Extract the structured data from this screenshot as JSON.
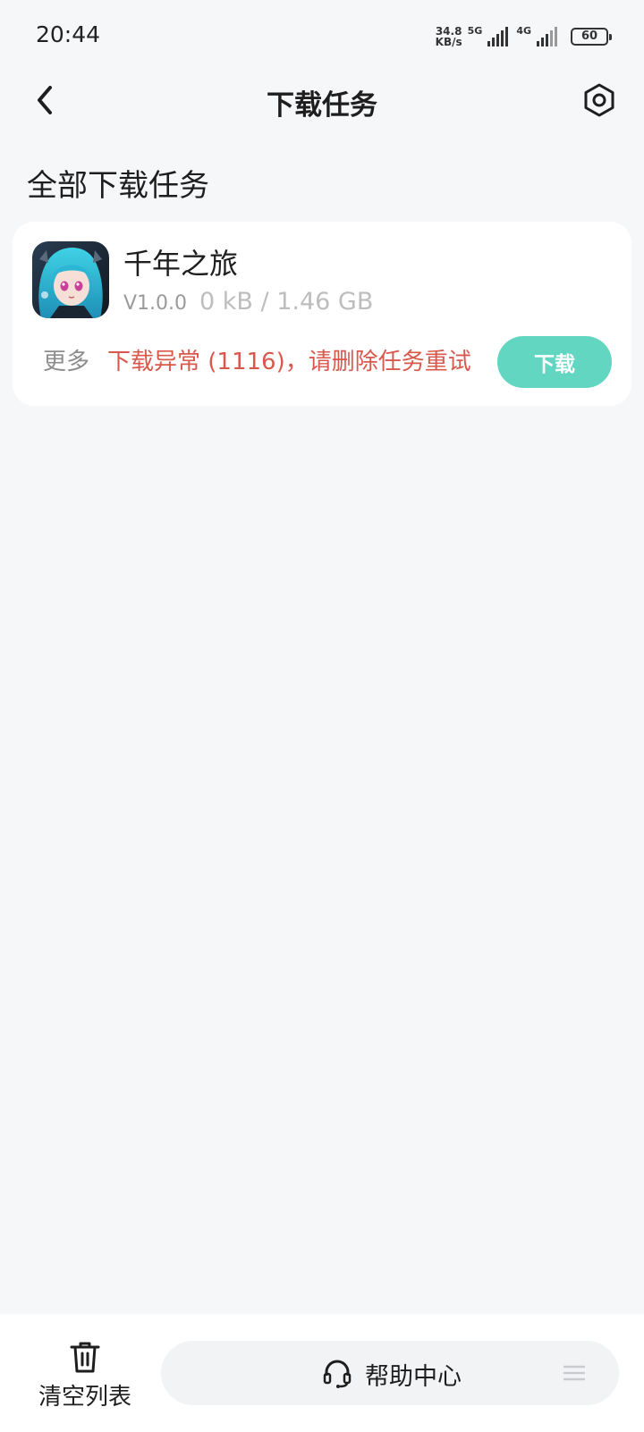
{
  "status_bar": {
    "time": "20:44",
    "net_speed_value": "34.8",
    "net_speed_unit": "KB/s",
    "network_1": "5G",
    "network_2": "4G",
    "battery": "60"
  },
  "nav": {
    "title": "下载任务",
    "back_icon": "chevron-left-icon",
    "settings_icon": "hexagon-settings-icon"
  },
  "section_title": "全部下载任务",
  "task": {
    "name": "千年之旅",
    "version": "V1.0.0",
    "size": "0 kB / 1.46 GB",
    "more_label": "更多",
    "error_message": "下载异常 (1116)，请删除任务重试",
    "download_label": "下载",
    "accent_color": "#62d6c1",
    "error_color": "#d9584c"
  },
  "bottom": {
    "clear_label": "清空列表",
    "help_label": "帮助中心",
    "trash_icon": "trash-icon",
    "headset_icon": "headset-icon",
    "menu_icon": "menu-icon"
  }
}
